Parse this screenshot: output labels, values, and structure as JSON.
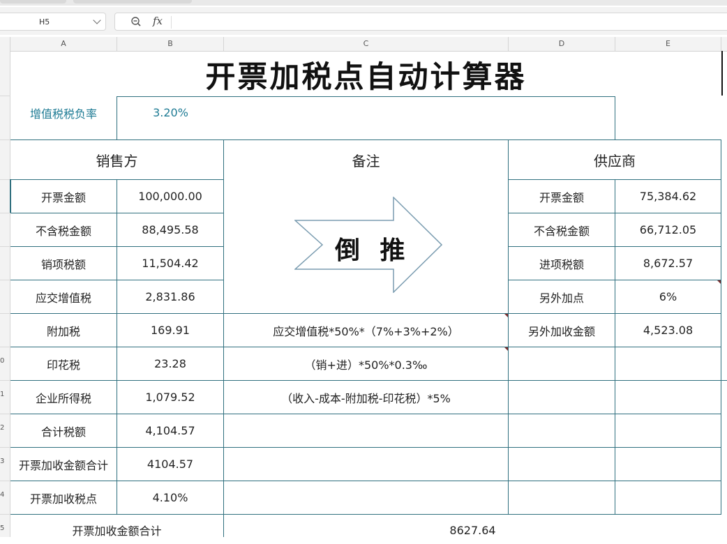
{
  "formula_bar": {
    "cell_ref": "H5",
    "fx_label": "fx",
    "formula": ""
  },
  "column_headers": [
    "A",
    "B",
    "C",
    "D",
    "E"
  ],
  "row_headers": [
    "0",
    "1",
    "2",
    "3",
    "4",
    "5"
  ],
  "title": "开票加税点自动计算器",
  "vat_burden": {
    "label": "增值税税负率",
    "value": "3.20%"
  },
  "section_headers": {
    "seller": "销售方",
    "remarks": "备注",
    "supplier": "供应商"
  },
  "seller_rows": [
    {
      "label": "开票金额",
      "value": "100,000.00"
    },
    {
      "label": "不含税金额",
      "value": "88,495.58"
    },
    {
      "label": "销项税额",
      "value": "11,504.42"
    },
    {
      "label": "应交增值税",
      "value": "2,831.86"
    },
    {
      "label": "附加税",
      "value": "169.91"
    },
    {
      "label": "印花税",
      "value": "23.28"
    },
    {
      "label": "企业所得税",
      "value": "1,079.52"
    },
    {
      "label": "合计税额",
      "value": "4,104.57"
    },
    {
      "label": "开票加收金额合计",
      "value": "4104.57"
    },
    {
      "label": "开票加收税点",
      "value": "4.10%"
    }
  ],
  "remarks": {
    "arrow_text": "倒 推",
    "surcharge_note": "应交增值税*50%*（7%+3%+2%）",
    "stamp_note": "（销+进）*50%*0.3‰",
    "income_tax_note": "（收入-成本-附加税-印花税）*5%"
  },
  "supplier_rows": [
    {
      "label": "开票金额",
      "value": "75,384.62"
    },
    {
      "label": "不含税金额",
      "value": "66,712.05"
    },
    {
      "label": "进项税额",
      "value": "8,672.57"
    },
    {
      "label": "另外加点",
      "value": "6%"
    },
    {
      "label": "另外加收金额",
      "value": "4,523.08"
    }
  ],
  "footer": {
    "label": "开票加收金额合计",
    "value": "8627.64"
  },
  "colors": {
    "grid": "#2f6f7e",
    "accent_text": "#1e7b94",
    "header_bg": "#f3f3f3",
    "comment_mark": "#7a2e2e"
  },
  "icons": [
    "zoom-icon",
    "chevron-down-icon",
    "arrow-right-icon"
  ]
}
